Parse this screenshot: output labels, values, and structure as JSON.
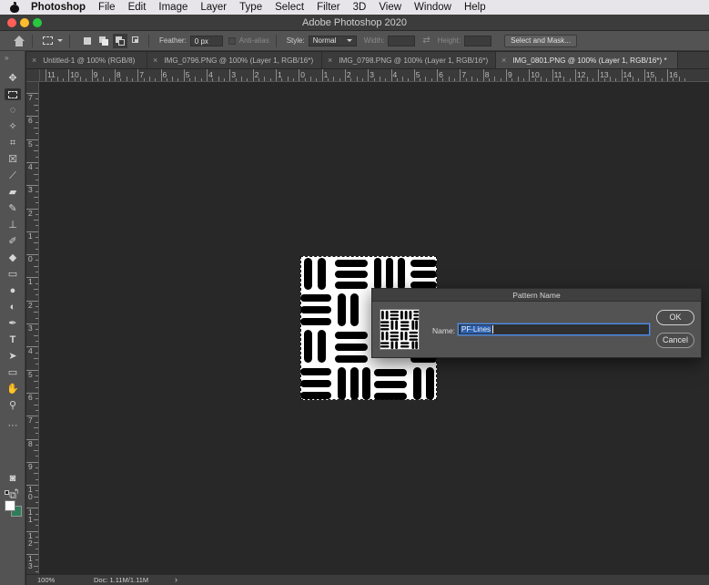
{
  "menubar": {
    "app": "Photoshop",
    "items": [
      "File",
      "Edit",
      "Image",
      "Layer",
      "Type",
      "Select",
      "Filter",
      "3D",
      "View",
      "Window",
      "Help"
    ]
  },
  "window": {
    "title": "Adobe Photoshop 2020"
  },
  "options": {
    "feather_label": "Feather:",
    "feather_value": "0 px",
    "antialias_label": "Anti-alias",
    "style_label": "Style:",
    "style_value": "Normal",
    "width_label": "Width:",
    "height_label": "Height:",
    "select_mask_label": "Select and Mask..."
  },
  "tabs": [
    {
      "label": "Untitled-1 @ 100% (RGB/8)",
      "active": false
    },
    {
      "label": "IMG_0796.PNG @ 100% (Layer 1, RGB/16*)",
      "active": false
    },
    {
      "label": "IMG_0798.PNG @ 100% (Layer 1, RGB/16*)",
      "active": false
    },
    {
      "label": "IMG_0801.PNG @ 100% (Layer 1, RGB/16*) *",
      "active": true
    }
  ],
  "ruler_h": [
    "11",
    "10",
    "9",
    "8",
    "7",
    "6",
    "5",
    "4",
    "3",
    "2",
    "1",
    "0",
    "1",
    "2",
    "3",
    "4",
    "5",
    "6",
    "7",
    "8",
    "9",
    "10",
    "11",
    "12",
    "13",
    "14",
    "15",
    "16"
  ],
  "ruler_v": [
    "7",
    "6",
    "5",
    "4",
    "3",
    "2",
    "1",
    "0",
    "1",
    "2",
    "3",
    "4",
    "5",
    "6",
    "7",
    "8",
    "9",
    "1 0",
    "1 1",
    "1 2",
    "1 3"
  ],
  "status": {
    "zoom": "100%",
    "doc": "Doc: 1.11M/1.11M"
  },
  "dialog": {
    "title": "Pattern Name",
    "name_label": "Name:",
    "name_value": "PF-Lines",
    "ok_label": "OK",
    "cancel_label": "Cancel"
  },
  "colors": {
    "foreground": "#ffffff",
    "background": "#2e7d5a",
    "accent": "#4a8ff0"
  },
  "toolbar_icons": [
    "move-icon",
    "rectangular-marquee-icon",
    "lasso-icon",
    "magic-wand-icon",
    "crop-icon",
    "frame-icon",
    "eyedropper-icon",
    "healing-brush-icon",
    "brush-icon",
    "clone-stamp-icon",
    "history-brush-icon",
    "eraser-icon",
    "gradient-icon",
    "blur-icon",
    "dodge-icon",
    "pen-icon",
    "type-icon",
    "path-selection-icon",
    "rectangle-icon",
    "hand-icon",
    "zoom-icon",
    "more-tools-icon",
    "quick-mask-icon",
    "screen-mode-icon"
  ]
}
